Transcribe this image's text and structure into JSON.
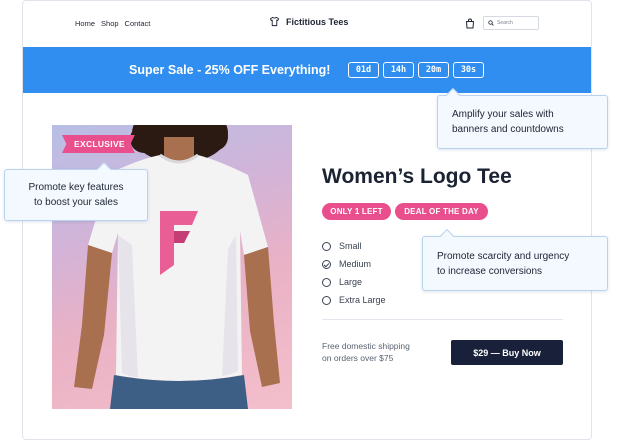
{
  "header": {
    "nav": [
      "Home",
      "Shop",
      "Contact"
    ],
    "brand": "Fictitious Tees",
    "search_placeholder": "Search"
  },
  "banner": {
    "text": "Super Sale - 25% OFF Everything!",
    "countdown": {
      "days": "01d",
      "hours": "14h",
      "minutes": "20m",
      "seconds": "30s"
    },
    "color": "#2f8ef0"
  },
  "product": {
    "ribbon": "EXCLUSIVE",
    "title": "Women’s Logo Tee",
    "badges": [
      "ONLY 1 LEFT",
      "DEAL OF THE DAY"
    ],
    "badge_color": "#e84f8c",
    "sizes": [
      {
        "label": "Small",
        "selected": false
      },
      {
        "label": "Medium",
        "selected": true
      },
      {
        "label": "Large",
        "selected": false
      },
      {
        "label": "Extra Large",
        "selected": false
      }
    ],
    "shipping_line1": "Free domestic shipping",
    "shipping_line2": "on orders over $75",
    "buy_label": "$29 — Buy Now"
  },
  "callouts": {
    "banners": {
      "line1": "Amplify your sales with",
      "line2": "banners and countdowns"
    },
    "features": {
      "line1": "Promote key features",
      "line2": "to boost your sales"
    },
    "scarcity": {
      "line1": "Promote scarcity and urgency",
      "line2": "to increase conversions"
    }
  },
  "icons": {
    "brand": "tshirt-icon",
    "cart": "shopping-bag-icon",
    "search": "search-icon"
  }
}
